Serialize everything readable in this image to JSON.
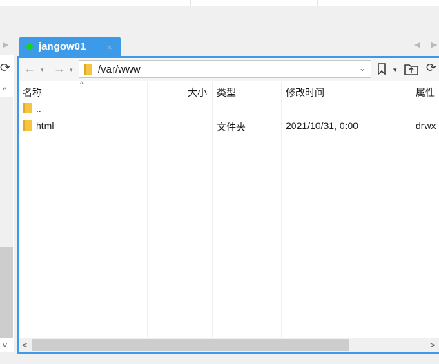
{
  "session_tab": {
    "label": "jangow01",
    "close_glyph": "×",
    "status_color": "#19d219"
  },
  "tab_scroll": {
    "left": "◀",
    "right": "▶"
  },
  "toolbar": {
    "back": "←",
    "back_caret": "▾",
    "forward": "→",
    "forward_caret": "▾",
    "path": "/var/www",
    "path_dropdown": "⌄",
    "bookmark": "⚑",
    "bookmark_caret": "▾",
    "refresh": "⟳"
  },
  "file_list": {
    "columns": [
      "名称",
      "大小",
      "类型",
      "修改时间",
      "属性"
    ],
    "sort_indicator": "^",
    "rows": [
      {
        "name": "..",
        "size": "",
        "type": "",
        "modified": "",
        "attributes": ""
      },
      {
        "name": "html",
        "size": "",
        "type": "文件夹",
        "modified": "2021/10/31, 0:00",
        "attributes": "drwx"
      }
    ]
  },
  "scrollbar": {
    "left_arrow": "<",
    "right_arrow": ">"
  },
  "left_panel": {
    "up_arrow": "^",
    "down_arrow": "v",
    "refresh": "⟳"
  },
  "colors": {
    "accent": "#3d9ae8",
    "folder": "#f5c542"
  }
}
